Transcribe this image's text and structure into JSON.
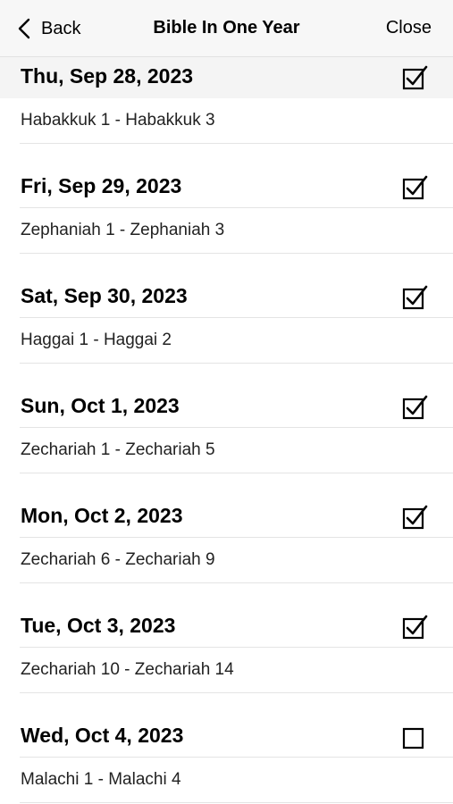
{
  "nav": {
    "back_label": "Back",
    "title": "Bible In One Year",
    "close_label": "Close"
  },
  "days": [
    {
      "date": "Thu, Sep 28, 2023",
      "reading": "Habakkuk 1 - Habakkuk 3",
      "checked": true
    },
    {
      "date": "Fri, Sep 29, 2023",
      "reading": "Zephaniah 1 - Zephaniah 3",
      "checked": true
    },
    {
      "date": "Sat, Sep 30, 2023",
      "reading": "Haggai 1 - Haggai 2",
      "checked": true
    },
    {
      "date": "Sun, Oct 1, 2023",
      "reading": "Zechariah 1 - Zechariah 5",
      "checked": true
    },
    {
      "date": "Mon, Oct 2, 2023",
      "reading": "Zechariah 6 - Zechariah 9",
      "checked": true
    },
    {
      "date": "Tue, Oct 3, 2023",
      "reading": "Zechariah 10 - Zechariah 14",
      "checked": true
    },
    {
      "date": "Wed, Oct 4, 2023",
      "reading": "Malachi 1 - Malachi 4",
      "checked": false
    }
  ]
}
